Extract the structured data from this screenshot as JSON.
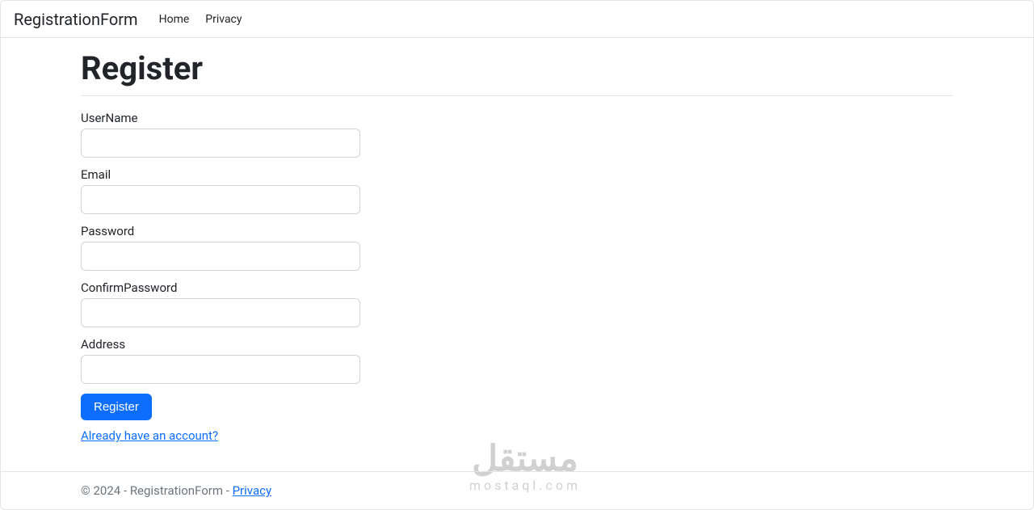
{
  "nav": {
    "brand": "RegistrationForm",
    "links": {
      "home": "Home",
      "privacy": "Privacy"
    }
  },
  "page": {
    "title": "Register"
  },
  "form": {
    "username_label": "UserName",
    "username_value": "",
    "email_label": "Email",
    "email_value": "",
    "password_label": "Password",
    "password_value": "",
    "confirmpassword_label": "ConfirmPassword",
    "confirmpassword_value": "",
    "address_label": "Address",
    "address_value": "",
    "register_button": "Register",
    "already_link": "Already have an account?"
  },
  "footer": {
    "copyright_prefix": "© 2024 - RegistrationForm - ",
    "privacy_link": "Privacy"
  },
  "watermark": {
    "top": "مستقل",
    "bottom": "mostaql.com"
  }
}
